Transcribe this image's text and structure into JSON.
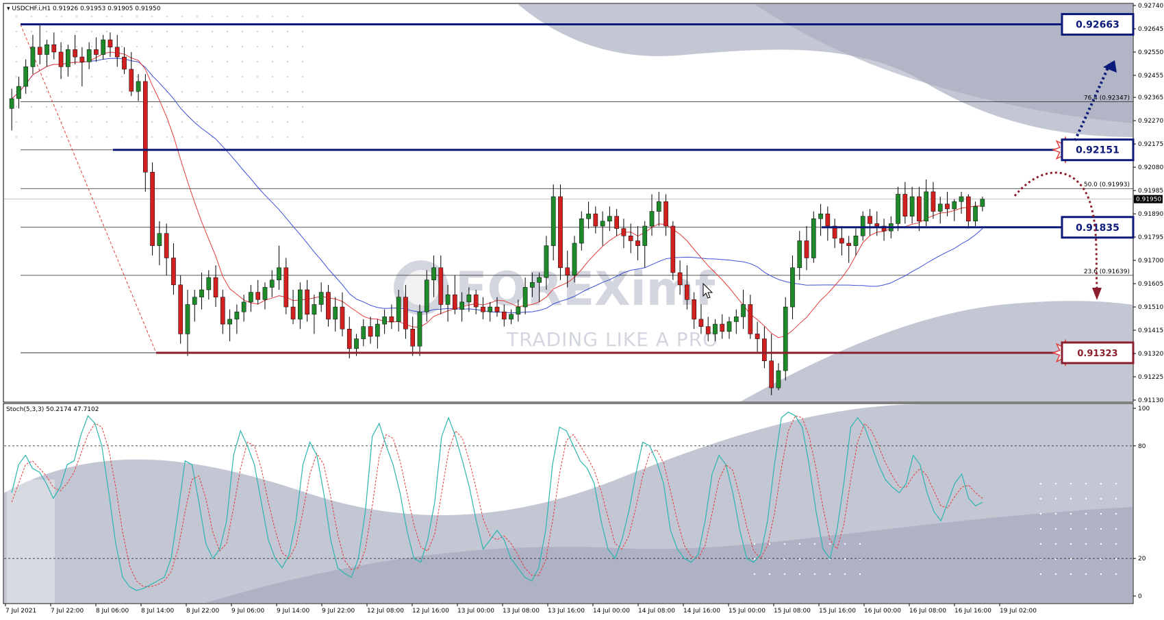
{
  "header": {
    "symbol": "USDCHF.i,H1",
    "ohlc": "0.91926 0.91953 0.91905 0.91950",
    "stoch_label": "Stoch(5,3,3) 50.2174 47.7102"
  },
  "watermark": {
    "brand": "FOREXimf",
    "tagline": "TRADING LIKE A PRO"
  },
  "price_axis": {
    "ticks": [
      "0.92740",
      "0.92645",
      "0.92550",
      "0.92455",
      "0.92365",
      "0.92270",
      "0.92175",
      "0.92080",
      "0.91985",
      "0.91890",
      "0.91795",
      "0.91700",
      "0.91605",
      "0.91510",
      "0.91415",
      "0.91320",
      "0.91225",
      "0.91130"
    ],
    "current": "0.91950"
  },
  "stoch_axis": {
    "ticks": [
      "100",
      "80",
      "20",
      "0"
    ]
  },
  "date_axis": {
    "labels": [
      "7 Jul 2021",
      "7 Jul 22:00",
      "8 Jul 06:00",
      "8 Jul 14:00",
      "8 Jul 22:00",
      "9 Jul 06:00",
      "9 Jul 14:00",
      "9 Jul 22:00",
      "12 Jul 08:00",
      "12 Jul 16:00",
      "13 Jul 00:00",
      "13 Jul 08:00",
      "13 Jul 16:00",
      "14 Jul 00:00",
      "14 Jul 08:00",
      "14 Jul 16:00",
      "15 Jul 00:00",
      "15 Jul 08:00",
      "15 Jul 16:00",
      "16 Jul 00:00",
      "16 Jul 08:00",
      "16 Jul 16:00",
      "19 Jul 02:00"
    ]
  },
  "levels": [
    {
      "label": "0.92663",
      "price": 0.92663,
      "style": "blue"
    },
    {
      "label": "0.92151",
      "price": 0.92151,
      "style": "blue"
    },
    {
      "label": "0.91835",
      "price": 0.91835,
      "style": "blue"
    },
    {
      "label": "0.91323",
      "price": 0.91323,
      "style": "red"
    }
  ],
  "fib_labels": [
    {
      "label": "76.4 (0.92347)",
      "price": 0.92347
    },
    {
      "label": "50.0 (0.91993)",
      "price": 0.91993
    },
    {
      "label": "23.6 (0.91639)",
      "price": 0.91639
    }
  ],
  "colors": {
    "bull": "#1f8a2a",
    "bear": "#d21f1f",
    "ma_fast": "#e43b3b",
    "ma_slow": "#3b4fd6",
    "stoch_main": "#2ab5b0",
    "stoch_signal": "#e43b3b",
    "level_blue": "#0b1a78",
    "level_red": "#8b1e2c"
  },
  "chart_data": {
    "type": "candlestick",
    "symbol": "USDCHF.i,H1",
    "ylim": [
      0.9113,
      0.9274
    ],
    "candles": [
      [
        0.9232,
        0.924,
        0.9223,
        0.9236
      ],
      [
        0.9236,
        0.9245,
        0.9232,
        0.9241
      ],
      [
        0.9241,
        0.9252,
        0.9238,
        0.9249
      ],
      [
        0.9249,
        0.9262,
        0.9246,
        0.9257
      ],
      [
        0.9257,
        0.9266,
        0.925,
        0.9254
      ],
      [
        0.9254,
        0.926,
        0.9249,
        0.9258
      ],
      [
        0.9258,
        0.9263,
        0.9252,
        0.9255
      ],
      [
        0.9255,
        0.9259,
        0.9244,
        0.9249
      ],
      [
        0.9249,
        0.9258,
        0.9245,
        0.9256
      ],
      [
        0.9256,
        0.9262,
        0.925,
        0.9253
      ],
      [
        0.9253,
        0.9257,
        0.9241,
        0.9251
      ],
      [
        0.9251,
        0.9259,
        0.9248,
        0.9256
      ],
      [
        0.9256,
        0.9261,
        0.9251,
        0.9254
      ],
      [
        0.9254,
        0.9262,
        0.9252,
        0.926
      ],
      [
        0.926,
        0.9263,
        0.9253,
        0.9257
      ],
      [
        0.9257,
        0.9262,
        0.9249,
        0.9253
      ],
      [
        0.9253,
        0.9257,
        0.9246,
        0.9248
      ],
      [
        0.9248,
        0.9255,
        0.9237,
        0.9239
      ],
      [
        0.9239,
        0.9246,
        0.9235,
        0.9243
      ],
      [
        0.9243,
        0.9246,
        0.9198,
        0.9206
      ],
      [
        0.9206,
        0.921,
        0.9172,
        0.9176
      ],
      [
        0.9176,
        0.9186,
        0.9168,
        0.9181
      ],
      [
        0.9181,
        0.9185,
        0.9164,
        0.9171
      ],
      [
        0.9171,
        0.9177,
        0.9156,
        0.916
      ],
      [
        0.916,
        0.9164,
        0.9136,
        0.914
      ],
      [
        0.914,
        0.9158,
        0.9131,
        0.9152
      ],
      [
        0.9152,
        0.9158,
        0.9145,
        0.9155
      ],
      [
        0.9155,
        0.9165,
        0.915,
        0.9158
      ],
      [
        0.9158,
        0.9166,
        0.9154,
        0.9163
      ],
      [
        0.9163,
        0.9168,
        0.9151,
        0.9155
      ],
      [
        0.9155,
        0.9158,
        0.914,
        0.9144
      ],
      [
        0.9144,
        0.915,
        0.9137,
        0.9146
      ],
      [
        0.9146,
        0.9152,
        0.914,
        0.9149
      ],
      [
        0.9149,
        0.9156,
        0.9145,
        0.9153
      ],
      [
        0.9153,
        0.916,
        0.9149,
        0.9157
      ],
      [
        0.9157,
        0.9162,
        0.9152,
        0.9154
      ],
      [
        0.9154,
        0.9161,
        0.915,
        0.9159
      ],
      [
        0.9159,
        0.9166,
        0.9155,
        0.9162
      ],
      [
        0.9162,
        0.9176,
        0.9158,
        0.9167
      ],
      [
        0.9167,
        0.9171,
        0.9148,
        0.9151
      ],
      [
        0.9151,
        0.9158,
        0.9144,
        0.9146
      ],
      [
        0.9146,
        0.9161,
        0.9142,
        0.9158
      ],
      [
        0.9158,
        0.9162,
        0.9145,
        0.9148
      ],
      [
        0.9148,
        0.9156,
        0.914,
        0.9152
      ],
      [
        0.9152,
        0.9161,
        0.9149,
        0.9157
      ],
      [
        0.9157,
        0.916,
        0.9143,
        0.9146
      ],
      [
        0.9146,
        0.9155,
        0.9141,
        0.9151
      ],
      [
        0.9151,
        0.9157,
        0.9139,
        0.9142
      ],
      [
        0.9142,
        0.9147,
        0.913,
        0.9134
      ],
      [
        0.9134,
        0.914,
        0.9131,
        0.9138
      ],
      [
        0.9138,
        0.9146,
        0.9135,
        0.9143
      ],
      [
        0.9143,
        0.9147,
        0.9136,
        0.9139
      ],
      [
        0.9139,
        0.9146,
        0.9134,
        0.9144
      ],
      [
        0.9144,
        0.915,
        0.914,
        0.9147
      ],
      [
        0.9147,
        0.9152,
        0.9142,
        0.9145
      ],
      [
        0.9145,
        0.9158,
        0.9141,
        0.9155
      ],
      [
        0.9155,
        0.916,
        0.9138,
        0.9142
      ],
      [
        0.9142,
        0.9147,
        0.9131,
        0.9135
      ],
      [
        0.9135,
        0.9152,
        0.9131,
        0.9149
      ],
      [
        0.9149,
        0.9166,
        0.9145,
        0.9162
      ],
      [
        0.9162,
        0.9172,
        0.9155,
        0.9167
      ],
      [
        0.9167,
        0.9172,
        0.9148,
        0.9152
      ],
      [
        0.9152,
        0.916,
        0.9145,
        0.9156
      ],
      [
        0.9156,
        0.9164,
        0.9148,
        0.915
      ],
      [
        0.915,
        0.9157,
        0.9145,
        0.9153
      ],
      [
        0.9153,
        0.9159,
        0.9149,
        0.9156
      ],
      [
        0.9156,
        0.9158,
        0.9148,
        0.9151
      ],
      [
        0.9151,
        0.9155,
        0.9146,
        0.9149
      ],
      [
        0.9149,
        0.9153,
        0.9145,
        0.9151
      ],
      [
        0.9151,
        0.9155,
        0.9147,
        0.9149
      ],
      [
        0.9149,
        0.9152,
        0.9143,
        0.9146
      ],
      [
        0.9146,
        0.915,
        0.9144,
        0.9148
      ],
      [
        0.9148,
        0.9154,
        0.9145,
        0.9151
      ],
      [
        0.9151,
        0.9163,
        0.9148,
        0.9159
      ],
      [
        0.9159,
        0.9165,
        0.9155,
        0.9161
      ],
      [
        0.9161,
        0.9165,
        0.9153,
        0.9163
      ],
      [
        0.9163,
        0.918,
        0.9158,
        0.9176
      ],
      [
        0.9176,
        0.9201,
        0.917,
        0.9196
      ],
      [
        0.9196,
        0.9201,
        0.9162,
        0.9167
      ],
      [
        0.9167,
        0.9174,
        0.9159,
        0.9164
      ],
      [
        0.9164,
        0.918,
        0.9161,
        0.9177
      ],
      [
        0.9177,
        0.919,
        0.9174,
        0.9187
      ],
      [
        0.9187,
        0.9194,
        0.9183,
        0.9189
      ],
      [
        0.9189,
        0.9192,
        0.9181,
        0.9184
      ],
      [
        0.9184,
        0.919,
        0.9176,
        0.9186
      ],
      [
        0.9186,
        0.9192,
        0.9182,
        0.9188
      ],
      [
        0.9188,
        0.9191,
        0.918,
        0.9183
      ],
      [
        0.9183,
        0.9187,
        0.9175,
        0.918
      ],
      [
        0.918,
        0.9185,
        0.9173,
        0.9178
      ],
      [
        0.9178,
        0.9184,
        0.917,
        0.9176
      ],
      [
        0.9176,
        0.9186,
        0.9167,
        0.9184
      ],
      [
        0.9184,
        0.9197,
        0.918,
        0.919
      ],
      [
        0.919,
        0.9198,
        0.9184,
        0.9194
      ],
      [
        0.9194,
        0.9197,
        0.918,
        0.9184
      ],
      [
        0.9184,
        0.9186,
        0.9162,
        0.9165
      ],
      [
        0.9165,
        0.917,
        0.9156,
        0.916
      ],
      [
        0.916,
        0.9168,
        0.915,
        0.9154
      ],
      [
        0.9154,
        0.9157,
        0.9142,
        0.9146
      ],
      [
        0.9146,
        0.9152,
        0.914,
        0.9143
      ],
      [
        0.9143,
        0.9147,
        0.9137,
        0.914
      ],
      [
        0.914,
        0.9146,
        0.9137,
        0.9144
      ],
      [
        0.9144,
        0.9148,
        0.9138,
        0.9141
      ],
      [
        0.9141,
        0.9147,
        0.9138,
        0.9145
      ],
      [
        0.9145,
        0.915,
        0.914,
        0.9147
      ],
      [
        0.9147,
        0.9158,
        0.9142,
        0.9152
      ],
      [
        0.9152,
        0.9156,
        0.9138,
        0.914
      ],
      [
        0.914,
        0.9145,
        0.9132,
        0.9138
      ],
      [
        0.9138,
        0.9143,
        0.9126,
        0.9129
      ],
      [
        0.9129,
        0.914,
        0.9115,
        0.9118
      ],
      [
        0.9118,
        0.9128,
        0.9117,
        0.9125
      ],
      [
        0.9125,
        0.9155,
        0.9121,
        0.9151
      ],
      [
        0.9151,
        0.9172,
        0.9146,
        0.9167
      ],
      [
        0.9167,
        0.9182,
        0.9162,
        0.9178
      ],
      [
        0.9178,
        0.9184,
        0.9166,
        0.9171
      ],
      [
        0.9171,
        0.919,
        0.9169,
        0.9187
      ],
      [
        0.9187,
        0.9193,
        0.918,
        0.9189
      ],
      [
        0.9189,
        0.9192,
        0.9178,
        0.9184
      ],
      [
        0.9184,
        0.9187,
        0.9175,
        0.9179
      ],
      [
        0.9179,
        0.9184,
        0.9172,
        0.9177
      ],
      [
        0.9177,
        0.918,
        0.9169,
        0.9176
      ],
      [
        0.9176,
        0.9183,
        0.9172,
        0.918
      ],
      [
        0.918,
        0.919,
        0.9178,
        0.9188
      ],
      [
        0.9188,
        0.9191,
        0.918,
        0.9185
      ],
      [
        0.9185,
        0.919,
        0.918,
        0.9184
      ],
      [
        0.9184,
        0.9187,
        0.9178,
        0.9182
      ],
      [
        0.9182,
        0.9188,
        0.9179,
        0.9185
      ],
      [
        0.9185,
        0.92,
        0.9182,
        0.9197
      ],
      [
        0.9197,
        0.9202,
        0.9185,
        0.9188
      ],
      [
        0.9188,
        0.92,
        0.9185,
        0.9196
      ],
      [
        0.9196,
        0.92,
        0.9182,
        0.9186
      ],
      [
        0.9186,
        0.9203,
        0.9184,
        0.9198
      ],
      [
        0.9198,
        0.9202,
        0.9187,
        0.919
      ],
      [
        0.919,
        0.9196,
        0.9185,
        0.9193
      ],
      [
        0.9193,
        0.9198,
        0.9188,
        0.9191
      ],
      [
        0.9191,
        0.9195,
        0.9186,
        0.9194
      ],
      [
        0.9194,
        0.9198,
        0.9189,
        0.9196
      ],
      [
        0.9196,
        0.9197,
        0.9183,
        0.9186
      ],
      [
        0.9186,
        0.9194,
        0.9184,
        0.9192
      ],
      [
        0.9192,
        0.9196,
        0.919,
        0.9195
      ]
    ],
    "stochastic": {
      "name": "Stoch(5,3,3)",
      "ylim": [
        0,
        100
      ],
      "levels": [
        80,
        20
      ],
      "main": [
        55,
        70,
        75,
        68,
        66,
        60,
        52,
        58,
        70,
        72,
        86,
        96,
        92,
        80,
        55,
        28,
        10,
        5,
        3,
        4,
        6,
        8,
        10,
        20,
        45,
        72,
        70,
        50,
        28,
        20,
        25,
        40,
        75,
        88,
        80,
        70,
        50,
        30,
        20,
        15,
        22,
        40,
        70,
        82,
        75,
        55,
        30,
        15,
        12,
        10,
        20,
        45,
        85,
        92,
        80,
        70,
        55,
        35,
        20,
        18,
        30,
        50,
        85,
        95,
        85,
        72,
        58,
        40,
        25,
        30,
        35,
        30,
        20,
        15,
        10,
        8,
        15,
        35,
        70,
        90,
        88,
        80,
        72,
        68,
        60,
        40,
        25,
        20,
        30,
        45,
        65,
        82,
        80,
        72,
        60,
        35,
        25,
        20,
        18,
        22,
        40,
        65,
        75,
        70,
        55,
        35,
        20,
        18,
        22,
        40,
        70,
        95,
        98,
        96,
        90,
        70,
        45,
        25,
        20,
        35,
        60,
        90,
        95,
        90,
        80,
        70,
        62,
        58,
        55,
        60,
        75,
        70,
        55,
        45,
        40,
        50,
        60,
        65,
        52,
        48,
        50
      ],
      "signal": [
        50,
        60,
        70,
        72,
        68,
        64,
        58,
        56,
        60,
        66,
        76,
        86,
        92,
        90,
        78,
        58,
        34,
        16,
        8,
        5,
        5,
        6,
        8,
        13,
        25,
        45,
        62,
        64,
        52,
        34,
        24,
        28,
        47,
        68,
        82,
        80,
        68,
        50,
        35,
        23,
        20,
        27,
        45,
        65,
        76,
        70,
        53,
        33,
        19,
        14,
        15,
        25,
        48,
        74,
        86,
        84,
        72,
        55,
        38,
        26,
        24,
        33,
        55,
        77,
        88,
        84,
        72,
        57,
        41,
        32,
        30,
        32,
        28,
        22,
        15,
        11,
        11,
        19,
        40,
        65,
        83,
        86,
        80,
        74,
        67,
        56,
        42,
        28,
        25,
        32,
        47,
        64,
        76,
        78,
        71,
        56,
        40,
        27,
        21,
        20,
        27,
        44,
        62,
        70,
        67,
        53,
        37,
        24,
        20,
        27,
        44,
        68,
        88,
        96,
        95,
        85,
        68,
        47,
        30,
        25,
        38,
        62,
        82,
        92,
        88,
        80,
        71,
        64,
        58,
        58,
        64,
        68,
        64,
        56,
        48,
        47,
        53,
        58,
        59,
        55,
        52
      ]
    }
  }
}
